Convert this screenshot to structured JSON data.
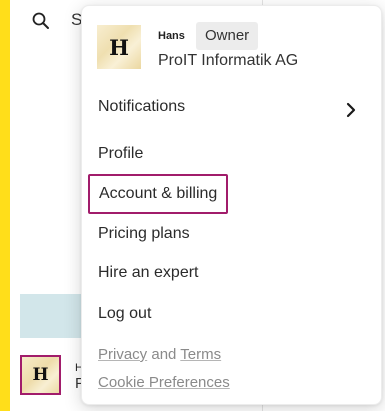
{
  "background": {
    "search_label": "S",
    "avatar_initial": "H",
    "user_initial_partial": "H",
    "user_sub_partial": "P",
    "colors": {
      "accent_strip": "#ffde1a",
      "focus_outline": "#a11c6b",
      "highlight_block": "#d2e6ea"
    }
  },
  "menu": {
    "avatar_initial": "H",
    "user_name": "Hans",
    "role": "Owner",
    "organization": "ProIT Informatik AG",
    "items": [
      {
        "label": "Notifications",
        "has_submenu": true
      },
      {
        "label": "Profile"
      },
      {
        "label": "Account & billing",
        "focused": true
      },
      {
        "label": "Pricing plans"
      },
      {
        "label": "Hire an expert"
      },
      {
        "label": "Log out"
      }
    ],
    "footer": {
      "privacy": "Privacy",
      "and": "and",
      "terms": "Terms",
      "cookie": "Cookie Preferences"
    }
  }
}
